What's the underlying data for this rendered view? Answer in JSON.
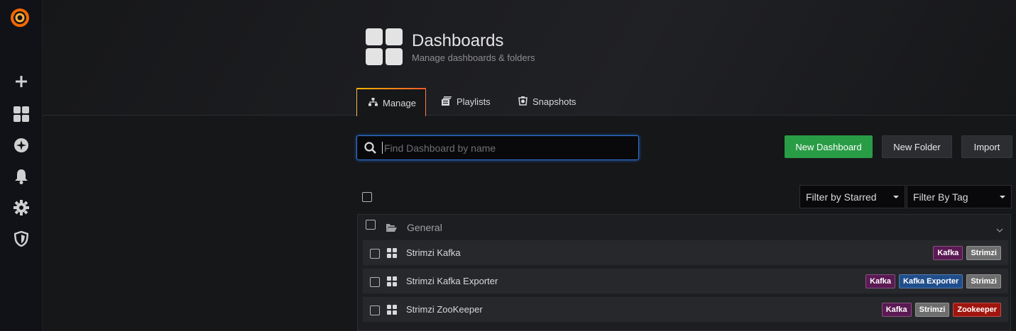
{
  "sidebar": {
    "items": [
      {
        "icon": "plus-icon",
        "label": "Create"
      },
      {
        "icon": "dashboards-icon",
        "label": "Dashboards"
      },
      {
        "icon": "explore-icon",
        "label": "Explore"
      },
      {
        "icon": "bell-icon",
        "label": "Alerting"
      },
      {
        "icon": "gear-icon",
        "label": "Configuration"
      },
      {
        "icon": "shield-icon",
        "label": "Server Admin"
      }
    ]
  },
  "header": {
    "title": "Dashboards",
    "subtitle": "Manage dashboards & folders"
  },
  "tabs": [
    {
      "label": "Manage",
      "icon": "sitemap-icon",
      "active": true
    },
    {
      "label": "Playlists",
      "icon": "playlist-icon",
      "active": false
    },
    {
      "label": "Snapshots",
      "icon": "snapshot-icon",
      "active": false
    }
  ],
  "search": {
    "placeholder": "Find Dashboard by name",
    "value": ""
  },
  "buttons": {
    "new_dashboard": "New Dashboard",
    "new_folder": "New Folder",
    "import": "Import"
  },
  "filters": {
    "starred": "Filter by Starred",
    "tag": "Filter By Tag"
  },
  "folder": {
    "name": "General",
    "dashboards": [
      {
        "title": "Strimzi Kafka",
        "tags": [
          "Kafka",
          "Strimzi"
        ]
      },
      {
        "title": "Strimzi Kafka Exporter",
        "tags": [
          "Kafka",
          "Kafka Exporter",
          "Strimzi"
        ]
      },
      {
        "title": "Strimzi ZooKeeper",
        "tags": [
          "Kafka",
          "Strimzi",
          "Zookeeper"
        ]
      }
    ]
  },
  "colors": {
    "accent_green": "#299c46",
    "focus_blue": "#3274d9",
    "tag_kafka": "#5b1a54",
    "tag_strimzi": "#6e6e6e",
    "tag_kafka_exporter": "#1f4e8c",
    "tag_zookeeper": "#a0160f"
  }
}
